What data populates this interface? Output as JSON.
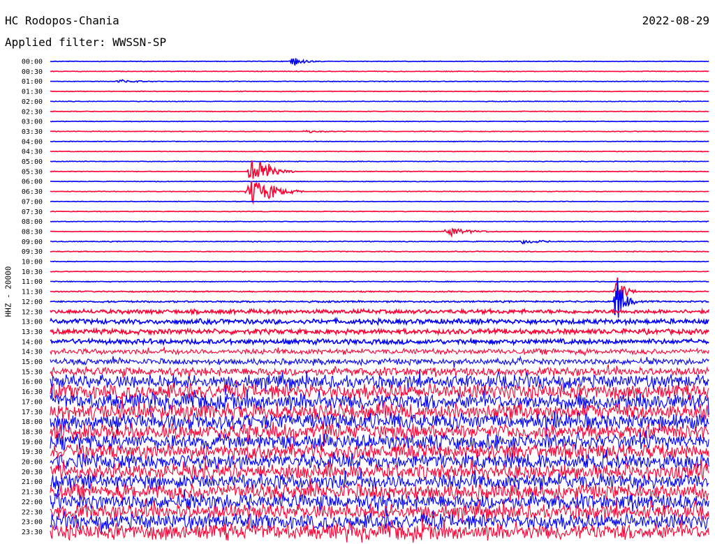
{
  "header": {
    "station": "HC Rodopos-Chania",
    "date": "2022-08-29",
    "filter": "Applied filter: WWSSN-SP"
  },
  "axis": {
    "channel_label": "HHZ - 20000"
  },
  "colors": {
    "blue": "#0000ff",
    "red": "#ff0033",
    "background": "#ffffff"
  },
  "chart_data": {
    "type": "line",
    "title": "HC Rodopos-Chania",
    "subtitle": "Applied filter: WWSSN-SP",
    "date": "2022-08-29",
    "ylabel": "HHZ - 20000",
    "xlabel": "",
    "grid": false,
    "row_labels": [
      "00:00",
      "00:30",
      "01:00",
      "01:30",
      "02:00",
      "02:30",
      "03:00",
      "03:30",
      "04:00",
      "04:30",
      "05:00",
      "05:30",
      "06:00",
      "06:30",
      "07:00",
      "07:30",
      "08:00",
      "08:30",
      "09:00",
      "09:30",
      "10:00",
      "10:30",
      "11:00",
      "11:30",
      "12:00",
      "12:30",
      "13:00",
      "13:30",
      "14:00",
      "14:30",
      "15:00",
      "15:30",
      "16:00",
      "16:30",
      "17:00",
      "17:30",
      "18:00",
      "18:30",
      "19:00",
      "19:30",
      "20:00",
      "20:30",
      "21:00",
      "21:30",
      "22:00",
      "22:30",
      "23:00",
      "23:30"
    ],
    "row_colors": [
      "blue",
      "red"
    ],
    "noise_level": [
      0.4,
      0.4,
      0.4,
      0.4,
      0.4,
      0.4,
      0.4,
      0.4,
      0.4,
      0.4,
      0.4,
      0.4,
      0.4,
      0.4,
      0.4,
      0.4,
      0.4,
      0.4,
      0.5,
      0.5,
      0.4,
      0.4,
      0.5,
      0.7,
      1.0,
      2.5,
      3.0,
      3.0,
      3.0,
      3.2,
      3.5,
      5.0,
      8.0,
      9.0,
      9.5,
      9.5,
      9.5,
      9.0,
      9.0,
      9.0,
      9.0,
      9.0,
      9.0,
      9.0,
      9.0,
      9.0,
      9.0,
      9.5
    ],
    "events": [
      {
        "row": "00:00",
        "x": 0.37,
        "amp": 7,
        "dur": 0.03
      },
      {
        "row": "01:00",
        "x": 0.11,
        "amp": 3,
        "dur": 0.04
      },
      {
        "row": "03:30",
        "x": 0.39,
        "amp": 2,
        "dur": 0.04
      },
      {
        "row": "05:30",
        "x": 0.31,
        "amp": 35,
        "dur": 0.04
      },
      {
        "row": "06:30",
        "x": 0.31,
        "amp": 30,
        "dur": 0.05
      },
      {
        "row": "08:30",
        "x": 0.61,
        "amp": 8,
        "dur": 0.05
      },
      {
        "row": "09:00",
        "x": 0.72,
        "amp": 4,
        "dur": 0.04
      },
      {
        "row": "11:30",
        "x": 0.86,
        "amp": 40,
        "dur": 0.02
      },
      {
        "row": "12:00",
        "x": 0.86,
        "amp": 45,
        "dur": 0.02
      }
    ]
  }
}
